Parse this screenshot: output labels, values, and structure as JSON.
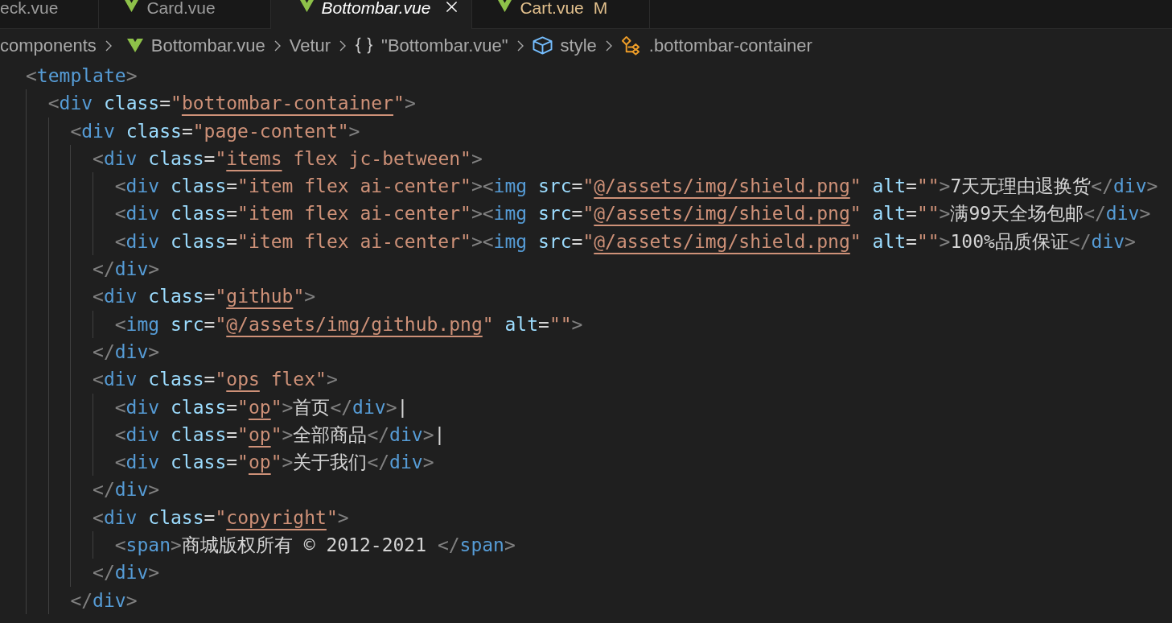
{
  "tabs": [
    {
      "label": "eck.vue",
      "selected": false,
      "preview": false,
      "modified": false
    },
    {
      "label": "Card.vue",
      "selected": false,
      "preview": false,
      "modified": false
    },
    {
      "label": "Bottombar.vue",
      "selected": true,
      "preview": true,
      "modified": false
    },
    {
      "label": "Cart.vue",
      "selected": false,
      "preview": false,
      "modified": true,
      "git_status": "M"
    }
  ],
  "breadcrumbs": [
    {
      "label": "components"
    },
    {
      "label": "Bottombar.vue"
    },
    {
      "label": "Vetur"
    },
    {
      "label": "\"Bottombar.vue\""
    },
    {
      "label": "style"
    },
    {
      "label": ".bottombar-container"
    }
  ],
  "code_lines": [
    {
      "tokens": [
        {
          "kind": "punct",
          "text": "<"
        },
        {
          "kind": "tag",
          "text": "template"
        },
        {
          "kind": "punct",
          "text": ">"
        }
      ],
      "children": [
        {
          "tokens": [
            {
              "kind": "punct",
              "text": "<"
            },
            {
              "kind": "tag",
              "text": "div"
            },
            {
              "kind": "attr",
              "text": " class"
            },
            {
              "kind": "op",
              "text": "="
            },
            {
              "kind": "string",
              "text": "\""
            },
            {
              "kind": "link",
              "text": "bottombar-container"
            },
            {
              "kind": "string",
              "text": "\""
            },
            {
              "kind": "punct",
              "text": ">"
            }
          ],
          "children": [
            {
              "tokens": [
                {
                  "kind": "punct",
                  "text": "<"
                },
                {
                  "kind": "tag",
                  "text": "div"
                },
                {
                  "kind": "attr",
                  "text": " class"
                },
                {
                  "kind": "op",
                  "text": "="
                },
                {
                  "kind": "string",
                  "text": "\"page-content\""
                },
                {
                  "kind": "punct",
                  "text": ">"
                }
              ],
              "children": [
                {
                  "tokens": [
                    {
                      "kind": "punct",
                      "text": "<"
                    },
                    {
                      "kind": "tag",
                      "text": "div"
                    },
                    {
                      "kind": "attr",
                      "text": " class"
                    },
                    {
                      "kind": "op",
                      "text": "="
                    },
                    {
                      "kind": "string",
                      "text": "\""
                    },
                    {
                      "kind": "link",
                      "text": "items"
                    },
                    {
                      "kind": "string",
                      "text": " flex jc-between\""
                    },
                    {
                      "kind": "punct",
                      "text": ">"
                    }
                  ],
                  "children": [
                    {
                      "tokens": [
                        {
                          "kind": "punct",
                          "text": "<"
                        },
                        {
                          "kind": "tag",
                          "text": "div"
                        },
                        {
                          "kind": "attr",
                          "text": " class"
                        },
                        {
                          "kind": "op",
                          "text": "="
                        },
                        {
                          "kind": "string",
                          "text": "\"item flex ai-center\""
                        },
                        {
                          "kind": "punct",
                          "text": "><"
                        },
                        {
                          "kind": "tag",
                          "text": "img"
                        },
                        {
                          "kind": "attr",
                          "text": " src"
                        },
                        {
                          "kind": "op",
                          "text": "="
                        },
                        {
                          "kind": "string",
                          "text": "\""
                        },
                        {
                          "kind": "link",
                          "text": "@/assets/img/shield.png"
                        },
                        {
                          "kind": "string",
                          "text": "\""
                        },
                        {
                          "kind": "attr",
                          "text": " alt"
                        },
                        {
                          "kind": "op",
                          "text": "="
                        },
                        {
                          "kind": "string",
                          "text": "\"\""
                        },
                        {
                          "kind": "punct",
                          "text": ">"
                        },
                        {
                          "kind": "text",
                          "text": "7天无理由退换货"
                        },
                        {
                          "kind": "punct",
                          "text": "</"
                        },
                        {
                          "kind": "tag",
                          "text": "div"
                        },
                        {
                          "kind": "punct",
                          "text": ">"
                        }
                      ]
                    },
                    {
                      "tokens": [
                        {
                          "kind": "punct",
                          "text": "<"
                        },
                        {
                          "kind": "tag",
                          "text": "div"
                        },
                        {
                          "kind": "attr",
                          "text": " class"
                        },
                        {
                          "kind": "op",
                          "text": "="
                        },
                        {
                          "kind": "string",
                          "text": "\"item flex ai-center\""
                        },
                        {
                          "kind": "punct",
                          "text": "><"
                        },
                        {
                          "kind": "tag",
                          "text": "img"
                        },
                        {
                          "kind": "attr",
                          "text": " src"
                        },
                        {
                          "kind": "op",
                          "text": "="
                        },
                        {
                          "kind": "string",
                          "text": "\""
                        },
                        {
                          "kind": "link",
                          "text": "@/assets/img/shield.png"
                        },
                        {
                          "kind": "string",
                          "text": "\""
                        },
                        {
                          "kind": "attr",
                          "text": " alt"
                        },
                        {
                          "kind": "op",
                          "text": "="
                        },
                        {
                          "kind": "string",
                          "text": "\"\""
                        },
                        {
                          "kind": "punct",
                          "text": ">"
                        },
                        {
                          "kind": "text",
                          "text": "满99天全场包邮"
                        },
                        {
                          "kind": "punct",
                          "text": "</"
                        },
                        {
                          "kind": "tag",
                          "text": "div"
                        },
                        {
                          "kind": "punct",
                          "text": ">"
                        }
                      ]
                    },
                    {
                      "tokens": [
                        {
                          "kind": "punct",
                          "text": "<"
                        },
                        {
                          "kind": "tag",
                          "text": "div"
                        },
                        {
                          "kind": "attr",
                          "text": " class"
                        },
                        {
                          "kind": "op",
                          "text": "="
                        },
                        {
                          "kind": "string",
                          "text": "\"item flex ai-center\""
                        },
                        {
                          "kind": "punct",
                          "text": "><"
                        },
                        {
                          "kind": "tag",
                          "text": "img"
                        },
                        {
                          "kind": "attr",
                          "text": " src"
                        },
                        {
                          "kind": "op",
                          "text": "="
                        },
                        {
                          "kind": "string",
                          "text": "\""
                        },
                        {
                          "kind": "link",
                          "text": "@/assets/img/shield.png"
                        },
                        {
                          "kind": "string",
                          "text": "\""
                        },
                        {
                          "kind": "attr",
                          "text": " alt"
                        },
                        {
                          "kind": "op",
                          "text": "="
                        },
                        {
                          "kind": "string",
                          "text": "\"\""
                        },
                        {
                          "kind": "punct",
                          "text": ">"
                        },
                        {
                          "kind": "text",
                          "text": "100%品质保证"
                        },
                        {
                          "kind": "punct",
                          "text": "</"
                        },
                        {
                          "kind": "tag",
                          "text": "div"
                        },
                        {
                          "kind": "punct",
                          "text": ">"
                        }
                      ]
                    }
                  ]
                },
                {
                  "tokens": [
                    {
                      "kind": "punct",
                      "text": "</"
                    },
                    {
                      "kind": "tag",
                      "text": "div"
                    },
                    {
                      "kind": "punct",
                      "text": ">"
                    }
                  ]
                },
                {
                  "tokens": [
                    {
                      "kind": "punct",
                      "text": "<"
                    },
                    {
                      "kind": "tag",
                      "text": "div"
                    },
                    {
                      "kind": "attr",
                      "text": " class"
                    },
                    {
                      "kind": "op",
                      "text": "="
                    },
                    {
                      "kind": "string",
                      "text": "\""
                    },
                    {
                      "kind": "link",
                      "text": "github"
                    },
                    {
                      "kind": "string",
                      "text": "\""
                    },
                    {
                      "kind": "punct",
                      "text": ">"
                    }
                  ],
                  "children": [
                    {
                      "tokens": [
                        {
                          "kind": "punct",
                          "text": "<"
                        },
                        {
                          "kind": "tag",
                          "text": "img"
                        },
                        {
                          "kind": "attr",
                          "text": " src"
                        },
                        {
                          "kind": "op",
                          "text": "="
                        },
                        {
                          "kind": "string",
                          "text": "\""
                        },
                        {
                          "kind": "link",
                          "text": "@/assets/img/github.png"
                        },
                        {
                          "kind": "string",
                          "text": "\""
                        },
                        {
                          "kind": "attr",
                          "text": " alt"
                        },
                        {
                          "kind": "op",
                          "text": "="
                        },
                        {
                          "kind": "string",
                          "text": "\"\""
                        },
                        {
                          "kind": "punct",
                          "text": ">"
                        }
                      ]
                    }
                  ]
                },
                {
                  "tokens": [
                    {
                      "kind": "punct",
                      "text": "</"
                    },
                    {
                      "kind": "tag",
                      "text": "div"
                    },
                    {
                      "kind": "punct",
                      "text": ">"
                    }
                  ]
                },
                {
                  "tokens": [
                    {
                      "kind": "punct",
                      "text": "<"
                    },
                    {
                      "kind": "tag",
                      "text": "div"
                    },
                    {
                      "kind": "attr",
                      "text": " class"
                    },
                    {
                      "kind": "op",
                      "text": "="
                    },
                    {
                      "kind": "string",
                      "text": "\""
                    },
                    {
                      "kind": "link",
                      "text": "ops"
                    },
                    {
                      "kind": "string",
                      "text": " flex\""
                    },
                    {
                      "kind": "punct",
                      "text": ">"
                    }
                  ],
                  "children": [
                    {
                      "tokens": [
                        {
                          "kind": "punct",
                          "text": "<"
                        },
                        {
                          "kind": "tag",
                          "text": "div"
                        },
                        {
                          "kind": "attr",
                          "text": " class"
                        },
                        {
                          "kind": "op",
                          "text": "="
                        },
                        {
                          "kind": "string",
                          "text": "\""
                        },
                        {
                          "kind": "link",
                          "text": "op"
                        },
                        {
                          "kind": "string",
                          "text": "\""
                        },
                        {
                          "kind": "punct",
                          "text": ">"
                        },
                        {
                          "kind": "text",
                          "text": "首页"
                        },
                        {
                          "kind": "punct",
                          "text": "</"
                        },
                        {
                          "kind": "tag",
                          "text": "div"
                        },
                        {
                          "kind": "punct",
                          "text": ">"
                        },
                        {
                          "kind": "text",
                          "text": "|"
                        }
                      ]
                    },
                    {
                      "tokens": [
                        {
                          "kind": "punct",
                          "text": "<"
                        },
                        {
                          "kind": "tag",
                          "text": "div"
                        },
                        {
                          "kind": "attr",
                          "text": " class"
                        },
                        {
                          "kind": "op",
                          "text": "="
                        },
                        {
                          "kind": "string",
                          "text": "\""
                        },
                        {
                          "kind": "link",
                          "text": "op"
                        },
                        {
                          "kind": "string",
                          "text": "\""
                        },
                        {
                          "kind": "punct",
                          "text": ">"
                        },
                        {
                          "kind": "text",
                          "text": "全部商品"
                        },
                        {
                          "kind": "punct",
                          "text": "</"
                        },
                        {
                          "kind": "tag",
                          "text": "div"
                        },
                        {
                          "kind": "punct",
                          "text": ">"
                        },
                        {
                          "kind": "text",
                          "text": "|"
                        }
                      ]
                    },
                    {
                      "tokens": [
                        {
                          "kind": "punct",
                          "text": "<"
                        },
                        {
                          "kind": "tag",
                          "text": "div"
                        },
                        {
                          "kind": "attr",
                          "text": " class"
                        },
                        {
                          "kind": "op",
                          "text": "="
                        },
                        {
                          "kind": "string",
                          "text": "\""
                        },
                        {
                          "kind": "link",
                          "text": "op"
                        },
                        {
                          "kind": "string",
                          "text": "\""
                        },
                        {
                          "kind": "punct",
                          "text": ">"
                        },
                        {
                          "kind": "text",
                          "text": "关于我们"
                        },
                        {
                          "kind": "punct",
                          "text": "</"
                        },
                        {
                          "kind": "tag",
                          "text": "div"
                        },
                        {
                          "kind": "punct",
                          "text": ">"
                        }
                      ]
                    }
                  ]
                },
                {
                  "tokens": [
                    {
                      "kind": "punct",
                      "text": "</"
                    },
                    {
                      "kind": "tag",
                      "text": "div"
                    },
                    {
                      "kind": "punct",
                      "text": ">"
                    }
                  ]
                },
                {
                  "tokens": [
                    {
                      "kind": "punct",
                      "text": "<"
                    },
                    {
                      "kind": "tag",
                      "text": "div"
                    },
                    {
                      "kind": "attr",
                      "text": " class"
                    },
                    {
                      "kind": "op",
                      "text": "="
                    },
                    {
                      "kind": "string",
                      "text": "\""
                    },
                    {
                      "kind": "link",
                      "text": "copyright"
                    },
                    {
                      "kind": "string",
                      "text": "\""
                    },
                    {
                      "kind": "punct",
                      "text": ">"
                    }
                  ],
                  "children": [
                    {
                      "tokens": [
                        {
                          "kind": "punct",
                          "text": "<"
                        },
                        {
                          "kind": "tag",
                          "text": "span"
                        },
                        {
                          "kind": "punct",
                          "text": ">"
                        },
                        {
                          "kind": "text",
                          "text": "商城版权所有 © 2012-2021 "
                        },
                        {
                          "kind": "punct",
                          "text": "</"
                        },
                        {
                          "kind": "tag",
                          "text": "span"
                        },
                        {
                          "kind": "punct",
                          "text": ">"
                        }
                      ]
                    }
                  ]
                },
                {
                  "tokens": [
                    {
                      "kind": "punct",
                      "text": "</"
                    },
                    {
                      "kind": "tag",
                      "text": "div"
                    },
                    {
                      "kind": "punct",
                      "text": ">"
                    }
                  ]
                }
              ]
            },
            {
              "tokens": [
                {
                  "kind": "punct",
                  "text": "</"
                },
                {
                  "kind": "tag",
                  "text": "div"
                },
                {
                  "kind": "punct",
                  "text": ">"
                }
              ]
            }
          ]
        }
      ]
    }
  ]
}
